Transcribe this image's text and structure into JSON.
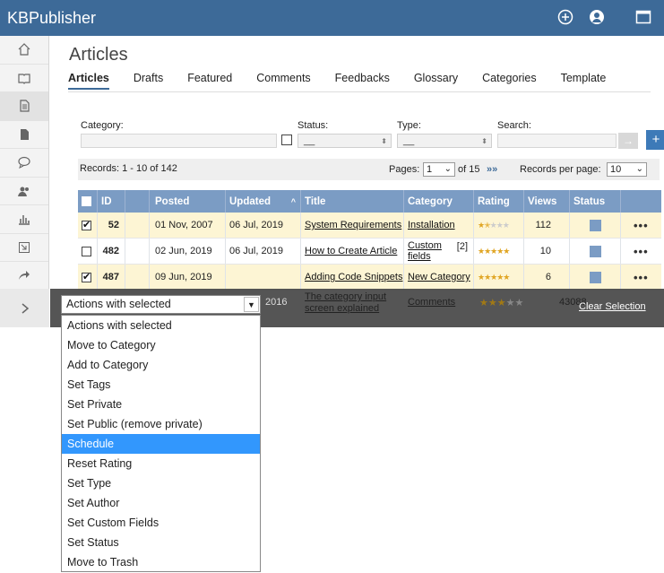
{
  "app": {
    "brand": "KBPublisher"
  },
  "page": {
    "title": "Articles"
  },
  "tabs": [
    "Articles",
    "Drafts",
    "Featured",
    "Comments",
    "Feedbacks",
    "Glossary",
    "Categories",
    "Template"
  ],
  "filters": {
    "category_label": "Category:",
    "status_label": "Status:",
    "type_label": "Type:",
    "search_label": "Search:",
    "status_value": "__",
    "type_value": "__",
    "go_symbol": "→",
    "add_symbol": "+"
  },
  "records": {
    "text": "Records: 1 - 10 of 142",
    "pages_label": "Pages:",
    "current_page": "1",
    "of_text": "of 15",
    "next": "»»",
    "per_page_label": "Records per page:",
    "per_page": "10"
  },
  "table": {
    "columns": [
      "ID",
      "Posted",
      "Updated",
      "Title",
      "Category",
      "Rating",
      "Views",
      "Status"
    ],
    "rows": [
      {
        "checked": true,
        "id": "52",
        "posted": "01 Nov, 2007",
        "updated": "06 Jul, 2019",
        "title": "System Requirements",
        "category": "Installation",
        "rating": 2,
        "views": "112"
      },
      {
        "checked": false,
        "id": "482",
        "posted": "02 Jun, 2019",
        "updated": "06 Jul, 2019",
        "title": "How to Create Article",
        "category": "Custom fields",
        "category_count": "[2]",
        "rating": 5,
        "views": "10"
      },
      {
        "checked": true,
        "id": "487",
        "posted": "09 Jun, 2019",
        "updated": "",
        "title": "Adding Code Snippets",
        "category": "New Category",
        "rating": 5,
        "views": "6"
      },
      {
        "checked": false,
        "id": "",
        "posted": "",
        "updated": "2016",
        "title": "The category input screen explained",
        "category": "Comments",
        "rating": 3,
        "views": "43088"
      }
    ]
  },
  "action_bar": {
    "selected": "Actions with selected",
    "clear": "Clear Selection",
    "options": [
      "Actions with selected",
      "Move to Category",
      "Add to Category",
      "Set Tags",
      "Set Private",
      "Set Public (remove private)",
      "Schedule",
      "Reset Rating",
      "Set Type",
      "Set Author",
      "Set Custom Fields",
      "Set Status",
      "Move to Trash"
    ],
    "highlighted": "Schedule"
  },
  "colors": {
    "topbar": "#3d6a98",
    "table_header": "#7b9cc4",
    "selected_row": "#fdf5d4",
    "highlight": "#3297fd"
  }
}
